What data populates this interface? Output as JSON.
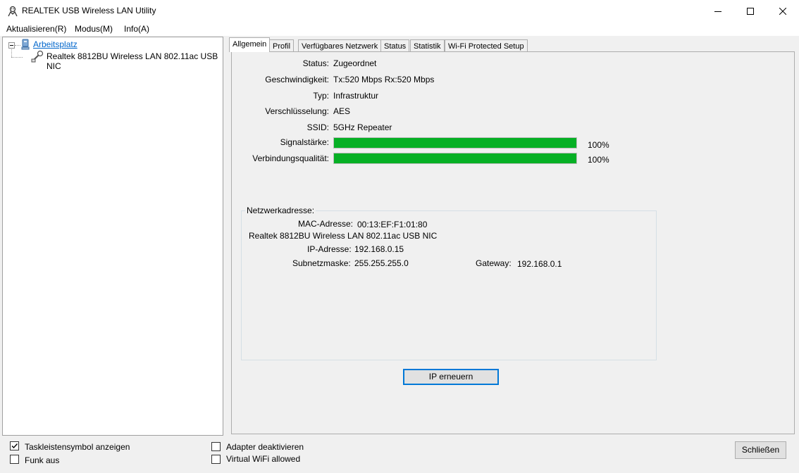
{
  "window": {
    "title": "REALTEK USB Wireless LAN Utility",
    "minimize_icon": "minimize-icon",
    "maximize_icon": "maximize-icon",
    "close_icon": "close-icon"
  },
  "menu": {
    "items": [
      "Aktualisieren(R)",
      "Modus(M)",
      "Info(A)"
    ]
  },
  "tree": {
    "root_label": "Arbeitsplatz",
    "child_label": "Realtek 8812BU Wireless LAN 802.11ac USB NIC"
  },
  "tabs": [
    "Allgemein",
    "Profil",
    "Verfügbares Netzwerk",
    "Status",
    "Statistik",
    "Wi-Fi Protected Setup"
  ],
  "active_tab": "Allgemein",
  "general": {
    "status_label": "Status:",
    "status_value": "Zugeordnet",
    "speed_label": "Geschwindigkeit:",
    "speed_value": "Tx:520 Mbps Rx:520 Mbps",
    "type_label": "Typ:",
    "type_value": "Infrastruktur",
    "encryption_label": "Verschlüsselung:",
    "encryption_value": "AES",
    "ssid_label": "SSID:",
    "ssid_value": "5GHz Repeater",
    "signal_label": "Signalstärke:",
    "signal_percent": 100,
    "signal_text": "100%",
    "quality_label": "Verbindungsqualität:",
    "quality_percent": 100,
    "quality_text": "100%",
    "bar_color": "#06b025"
  },
  "network": {
    "group_title": "Netzwerkadresse:",
    "mac_label": "MAC-Adresse:",
    "mac_value": "00:13:EF:F1:01:80",
    "adapter_name": "Realtek 8812BU Wireless LAN 802.11ac USB NIC",
    "ip_label": "IP-Adresse:",
    "ip_value": "192.168.0.15",
    "subnet_label": "Subnetzmaske:",
    "subnet_value": "255.255.255.0",
    "gateway_label": "Gateway:",
    "gateway_value": "192.168.0.1"
  },
  "buttons": {
    "renew_ip": "IP erneuern",
    "close": "Schließen"
  },
  "options": {
    "tray_icon": {
      "label": "Taskleistensymbol anzeigen",
      "checked": true
    },
    "radio_off": {
      "label": "Funk aus",
      "checked": false
    },
    "disable_adapter": {
      "label": "Adapter deaktivieren",
      "checked": false
    },
    "virtual_wifi": {
      "label": "Virtual WiFi allowed",
      "checked": false
    }
  }
}
